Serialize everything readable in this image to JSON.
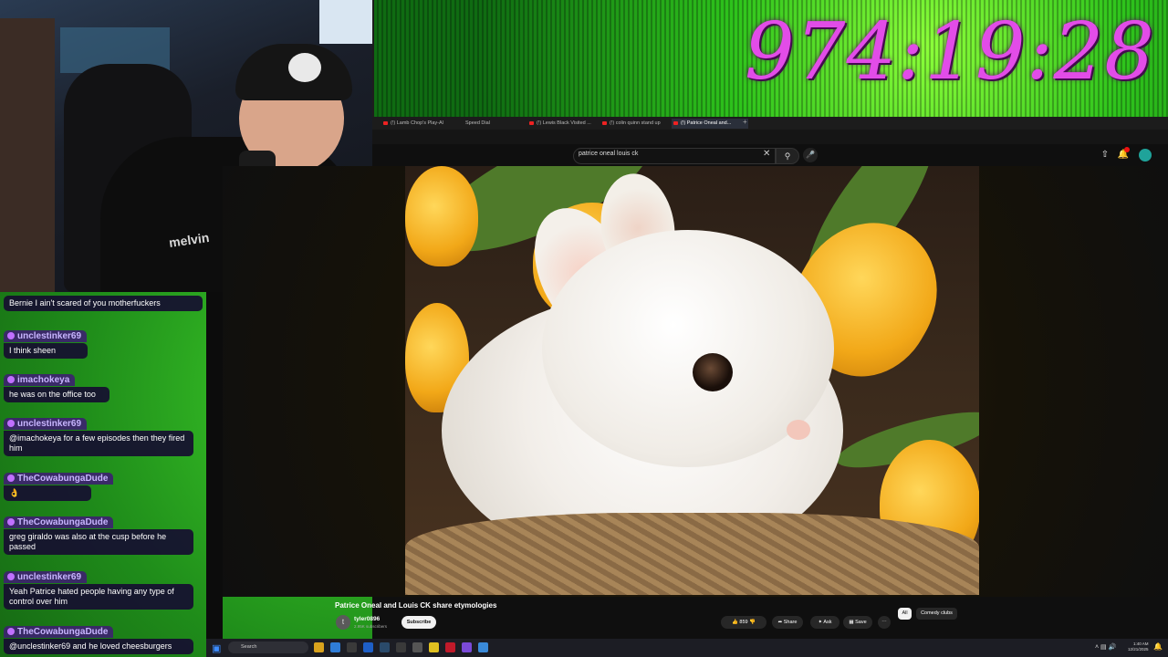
{
  "overlay": {
    "timer": "974:19:28"
  },
  "webcam": {
    "shirt_text": "melvin"
  },
  "browser": {
    "tabs": [
      {
        "label": "(!) Lamb Chop's Play-Al"
      },
      {
        "label": "Speed Dial"
      },
      {
        "label": "(!) Lewis Black Visited ..."
      },
      {
        "label": "(!) colin quinn stand up"
      },
      {
        "label": "(!) Patrice Oneal and..."
      }
    ]
  },
  "youtube": {
    "search": {
      "query": "patrice oneal louis ck",
      "clear_icon": "✕",
      "search_icon": "search-icon",
      "mic_icon": "mic-icon"
    },
    "video": {
      "title": "Patrice Oneal and Louis CK share etymologies",
      "channel": "tyler0896",
      "channel_initial": "t",
      "subscribers": "2.95K subscribers",
      "subscribe_label": "Subscribe",
      "likes": "859",
      "share_label": "Share",
      "ask_label": "Ask",
      "save_label": "Save",
      "more_label": "⋯"
    },
    "chips": [
      {
        "label": "All"
      },
      {
        "label": "Comedy clubs"
      }
    ]
  },
  "chat": {
    "messages": [
      {
        "user": "",
        "text": "Bernie I ain't scared of you motherfuckers"
      },
      {
        "user": "unclestinker69",
        "text": "I think sheen"
      },
      {
        "user": "imachokeya",
        "text": "he was on the office too"
      },
      {
        "user": "unclestinker69",
        "text": "@imachokeya for a few episodes then they fired him"
      },
      {
        "user": "TheCowabungaDude",
        "text": "👌"
      },
      {
        "user": "TheCowabungaDude",
        "text": "greg giraldo was also at the cusp before he passed"
      },
      {
        "user": "unclestinker69",
        "text": "Yeah Patrice hated people having any type of control over him"
      },
      {
        "user": "TheCowabungaDude",
        "text": "@unclestinker69 and he loved cheesburgers"
      }
    ]
  },
  "taskbar": {
    "search_placeholder": "Search",
    "time": "1:40 AM",
    "date": "12/21/2025"
  },
  "colors": {
    "timer": "#e24ce8",
    "chat_user_bg": "#3c236e",
    "chat_text_bg": "#160e30",
    "youtube_bg": "#0f0f0f"
  }
}
